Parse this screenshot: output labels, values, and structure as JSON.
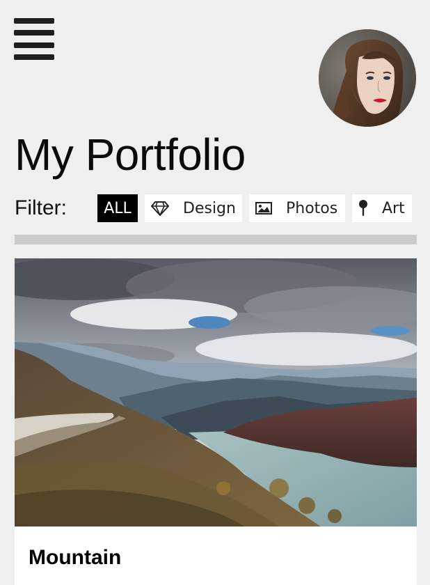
{
  "header": {
    "menu_icon": "hamburger-menu-icon",
    "avatar_alt": "profile avatar",
    "title": "My Portfolio"
  },
  "filter": {
    "label": "Filter:",
    "buttons": [
      {
        "label": "ALL",
        "icon": "",
        "active": true
      },
      {
        "label": "Design",
        "icon": "diamond-icon",
        "active": false
      },
      {
        "label": "Photos",
        "icon": "photo-icon",
        "active": false
      },
      {
        "label": "Art",
        "icon": "pushpin-icon",
        "active": false
      }
    ]
  },
  "cards": [
    {
      "title": "Mountain",
      "image": "mountain-lake-landscape"
    }
  ],
  "colors": {
    "background": "#efefef",
    "active_filter_bg": "#000000",
    "filter_bg": "#ffffff",
    "divider": "#cccccc",
    "menu_bars": "#1e1e1e"
  }
}
